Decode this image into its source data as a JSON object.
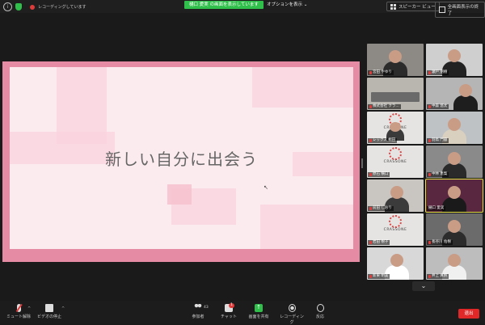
{
  "topbar": {
    "recording_text": "レコーディングしています",
    "share_banner": "樋口 愛実 の画面を表示しています",
    "view_option": "オプションを表示",
    "speaker_view": "スピーカー ビュー",
    "fullscreen": "全画面表示の終了"
  },
  "slide": {
    "title": "新しい自分に出会う"
  },
  "participants": [
    {
      "name": "宮田 やゆり"
    },
    {
      "name": "瀬戸 朋樹"
    },
    {
      "name": "株式会社 クラ..."
    },
    {
      "name": "中森 悠太"
    },
    {
      "name": "レックス 桐田"
    },
    {
      "name": "羽鳥 門脇"
    },
    {
      "name": "原石 横口"
    },
    {
      "name": "中林 恵梨"
    },
    {
      "name": "前田 しおり"
    },
    {
      "name": "樋口 愛実"
    },
    {
      "name": "岩田 樹子"
    },
    {
      "name": "長谷川 佑樹"
    },
    {
      "name": "新東 明美"
    },
    {
      "name": "井上 真帆"
    }
  ],
  "logos": {
    "crassone": "CRASSONE"
  },
  "bottombar": {
    "unmute": "ミュート解除",
    "stop_video": "ビデオの停止",
    "participants": "参加者",
    "participants_count": "43",
    "chat": "チャット",
    "chat_badge": "1",
    "share": "画面を共有",
    "record": "レコーディング",
    "reactions": "反応",
    "leave": "退出"
  },
  "colors": {
    "share_green": "#2fbf4a",
    "leave_red": "#e02828",
    "slide_frame": "#e58ca4",
    "active_speaker": "#e5e04a"
  }
}
